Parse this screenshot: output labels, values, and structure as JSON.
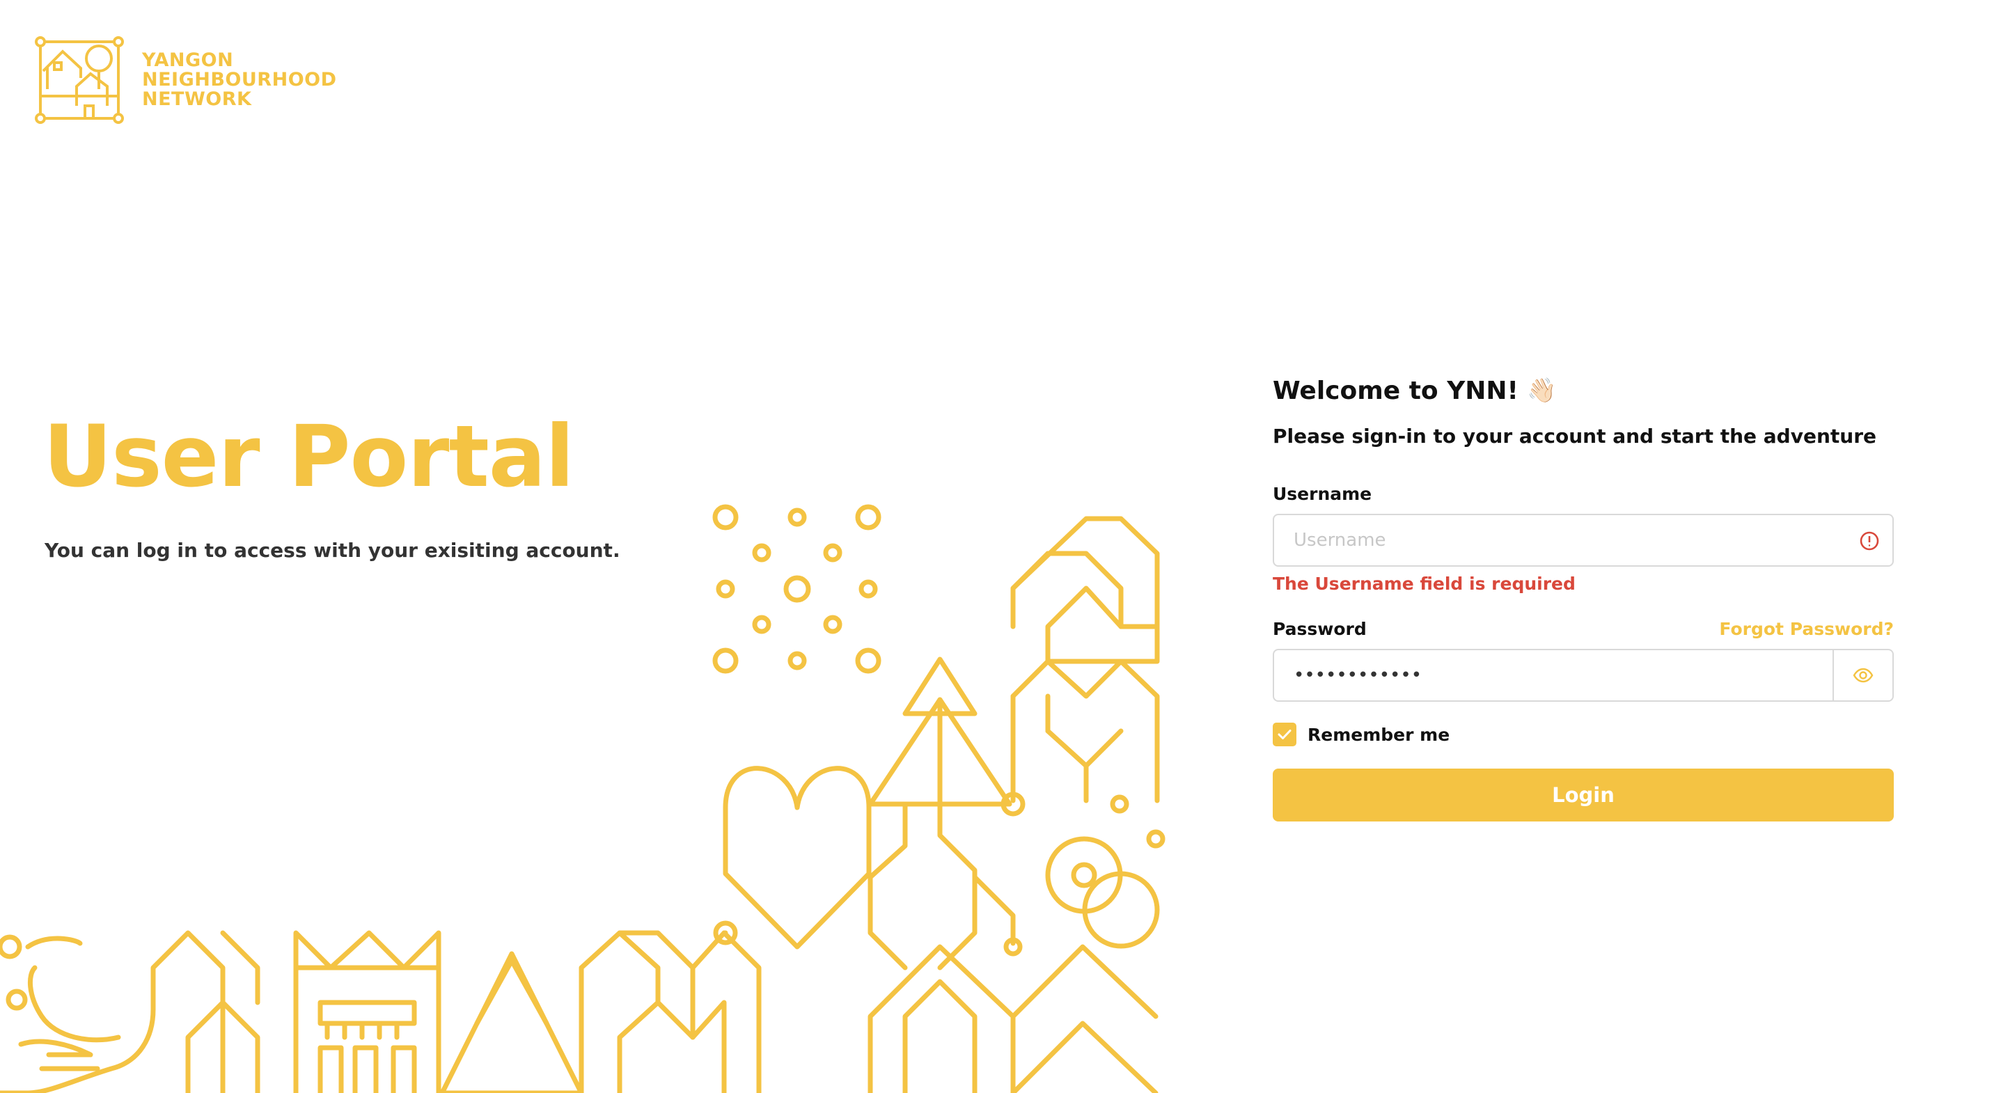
{
  "brand": {
    "line1": "YANGON",
    "line2": "NEIGHBOURHOOD",
    "line3": "NETWORK",
    "color": "#F4C343"
  },
  "hero": {
    "title": "User Portal",
    "subtitle": "You can log in to access with your exisiting account."
  },
  "form": {
    "welcome": "Welcome to YNN!",
    "welcome_emoji": "👋🏻",
    "subtitle": "Please sign-in to your account and start the adventure",
    "username_label": "Username",
    "username_placeholder": "Username",
    "username_value": "",
    "username_error": "The Username field is required",
    "password_label": "Password",
    "password_value": "••••••••••••",
    "forgot_label": "Forgot Password?",
    "remember_label": "Remember me",
    "remember_checked": true,
    "login_label": "Login"
  },
  "colors": {
    "accent": "#F4C343",
    "error": "#D9483B"
  },
  "icons": {
    "error": "alert-circle-icon",
    "password_toggle": "eye-icon",
    "checkbox": "check-icon"
  }
}
